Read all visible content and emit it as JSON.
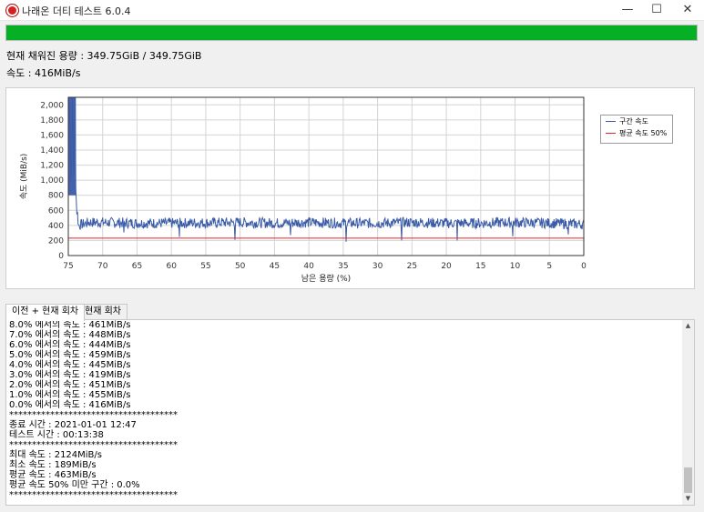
{
  "window": {
    "title": "나래온 더티 테스트 6.0.4",
    "minimize": "—",
    "maximize": "☐",
    "close": "✕"
  },
  "progress": {
    "value": 1.0,
    "color": "#06b025"
  },
  "info": {
    "written": "현재 채워진 용량 : 349.75GiB / 349.75GiB",
    "speed": "속도 : 416MiB/s"
  },
  "chart_data": {
    "type": "line",
    "xlabel": "남은 용량 (%)",
    "ylabel": "속도 (MiB/s)",
    "x_ticks": [
      75,
      70,
      65,
      60,
      55,
      50,
      45,
      40,
      35,
      30,
      25,
      20,
      15,
      10,
      5,
      0
    ],
    "y_ticks": [
      "0",
      "200",
      "400",
      "600",
      "800",
      "1,000",
      "1,200",
      "1,400",
      "1,600",
      "1,800",
      "2,000"
    ],
    "xlim": [
      75,
      0
    ],
    "ylim": [
      0,
      2100
    ],
    "grid": true,
    "legend_position": "top-right",
    "series": [
      {
        "name": "구간 속도",
        "color": "#3a5ba8",
        "x": [
          75,
          74.8,
          74.6,
          74.4,
          74.2,
          74.0,
          73.9,
          73.7,
          73.5,
          72,
          70,
          65,
          60,
          55,
          50,
          45,
          40,
          35,
          30,
          25,
          20,
          15,
          10,
          5,
          0
        ],
        "y": [
          2000,
          2100,
          900,
          2100,
          950,
          2050,
          800,
          560,
          400,
          440,
          440,
          430,
          430,
          435,
          440,
          430,
          440,
          430,
          430,
          440,
          430,
          430,
          440,
          430,
          416
        ]
      },
      {
        "name": "평균 속도 50%",
        "color": "#e0262a",
        "x": [
          75,
          0
        ],
        "y": [
          231,
          231
        ]
      }
    ]
  },
  "tabs": [
    {
      "label": "이전 + 현재 회차",
      "active": true
    },
    {
      "label": "현재 회차",
      "active": false
    }
  ],
  "log": [
    "8.0% 에서의 속도 : 461MiB/s",
    "7.0% 에서의 속도 : 448MiB/s",
    "6.0% 에서의 속도 : 444MiB/s",
    "5.0% 에서의 속도 : 459MiB/s",
    "4.0% 에서의 속도 : 445MiB/s",
    "3.0% 에서의 속도 : 419MiB/s",
    "2.0% 에서의 속도 : 451MiB/s",
    "1.0% 에서의 속도 : 455MiB/s",
    "0.0% 에서의 속도 : 416MiB/s",
    "*************************************",
    "종료 시간 : 2021-01-01 12:47",
    "테스트 시간 : 00:13:38",
    "*************************************",
    "최대 속도 : 2124MiB/s",
    "최소 속도 : 189MiB/s",
    "평균 속도 : 463MiB/s",
    "평균 속도 50% 미만 구간 : 0.0%",
    "*************************************"
  ],
  "scrollbar": {
    "position": 1.0
  },
  "icons": {
    "scroll_up": "▲",
    "scroll_down": "▼"
  }
}
